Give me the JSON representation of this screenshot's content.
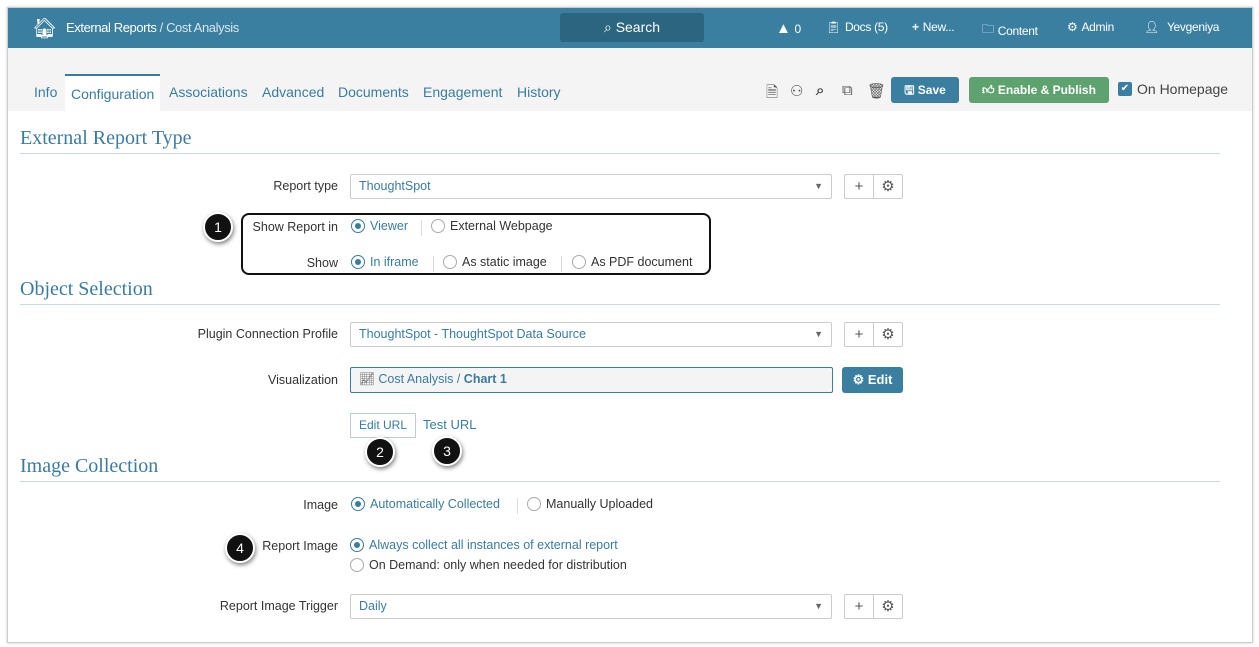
{
  "header": {
    "breadcrumb_root": "External Reports",
    "breadcrumb_sep": " / ",
    "breadcrumb_current": "Cost Analysis",
    "search": "Search",
    "alerts": "0",
    "docs": "Docs (5)",
    "new": "New...",
    "content": "Content",
    "admin": "Admin",
    "user": "Yevgeniya"
  },
  "tabs": [
    "Info",
    "Configuration",
    "Associations",
    "Advanced",
    "Documents",
    "Engagement",
    "History"
  ],
  "toolbar": {
    "save": "Save",
    "publish": "Enable & Publish",
    "homepage": "On Homepage"
  },
  "sections": {
    "report_type": "External Report Type",
    "object": "Object Selection",
    "image": "Image Collection"
  },
  "form": {
    "report_type_label": "Report type",
    "report_type_value": "ThoughtSpot",
    "show_in_label": "Show Report in",
    "show_in_options": [
      "Viewer",
      "External Webpage"
    ],
    "show_label": "Show",
    "show_options": [
      "In iframe",
      "As static image",
      "As PDF document"
    ],
    "profile_label": "Plugin Connection Profile",
    "profile_value": "ThoughtSpot - ThoughtSpot Data Source",
    "viz_label": "Visualization",
    "viz_path": "Cost Analysis / ",
    "viz_name": "Chart 1",
    "edit": "Edit",
    "edit_url": "Edit URL",
    "test_url": "Test URL",
    "image_label": "Image",
    "image_options": [
      "Automatically Collected",
      "Manually Uploaded"
    ],
    "report_image_label": "Report Image",
    "report_image_options": [
      "Always collect all instances of external report",
      "On Demand: only when needed for distribution"
    ],
    "trigger_label": "Report Image Trigger",
    "trigger_value": "Daily"
  },
  "badges": [
    "1",
    "2",
    "3",
    "4"
  ]
}
